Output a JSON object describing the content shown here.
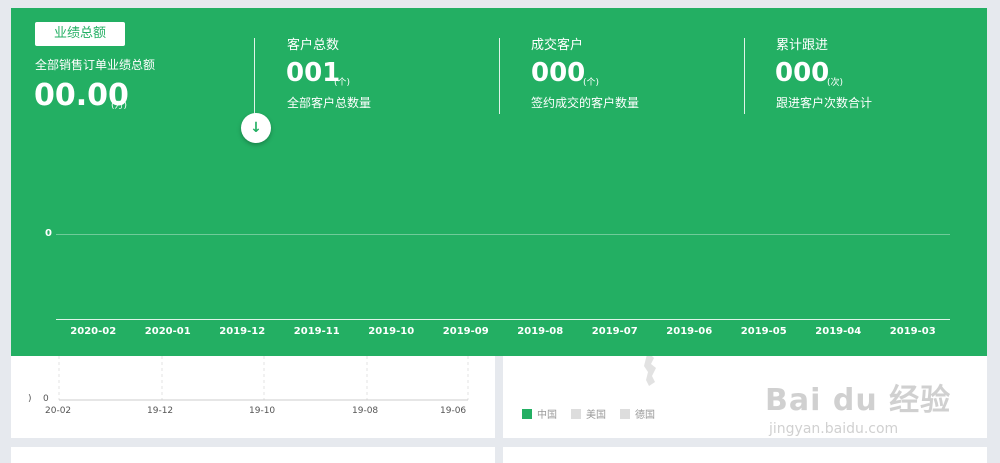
{
  "panel": {
    "color": "#23af63",
    "kpis": [
      {
        "title": "业绩总额",
        "subtitle": "全部销售订单业绩总额",
        "value": "00.00",
        "unit": "(万)"
      },
      {
        "title": "客户总数",
        "value": "001",
        "unit": "(个)",
        "desc": "全部客户总数量"
      },
      {
        "title": "成交客户",
        "value": "000",
        "unit": "(个)",
        "desc": "签约成交的客户数量"
      },
      {
        "title": "累计跟进",
        "value": "000",
        "unit": "(次)",
        "desc": "跟进客户次数合计"
      }
    ],
    "toggle_icon": "↓",
    "chart": {
      "y_label": "0",
      "x_ticks": [
        "2020-02",
        "2020-01",
        "2019-12",
        "2019-11",
        "2019-10",
        "2019-09",
        "2019-08",
        "2019-07",
        "2019-06",
        "2019-05",
        "2019-04",
        "2019-03"
      ]
    }
  },
  "mini_chart": {
    "y_label": "0",
    "x_ticks": [
      "20-02",
      "19-12",
      "19-10",
      "19-08",
      "19-06"
    ]
  },
  "legend": [
    {
      "label": "中国",
      "color": "#23af63"
    },
    {
      "label": "美国",
      "color": "#dddddd"
    },
    {
      "label": "德国",
      "color": "#dddddd"
    }
  ],
  "watermark": {
    "brand": "Bai du 经验",
    "url": "jingyan.baidu.com"
  }
}
